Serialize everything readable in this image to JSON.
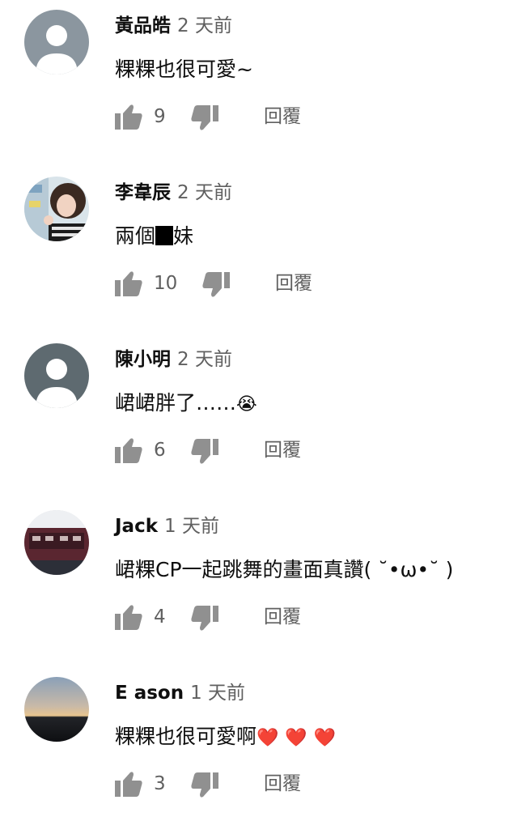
{
  "comments": [
    {
      "author": "黃品皓",
      "time": "2 天前",
      "text": "粿粿也很可愛~",
      "likes": "9",
      "reply": "回覆",
      "avatar": "default"
    },
    {
      "author": "李韋辰",
      "time": "2 天前",
      "text_before": "兩個",
      "text_after": "妹",
      "likes": "10",
      "reply": "回覆",
      "avatar": "photo-person"
    },
    {
      "author": "陳小明",
      "time": "2 天前",
      "text": "峮峮胖了……",
      "emoji": "😭",
      "likes": "6",
      "reply": "回覆",
      "avatar": "default"
    },
    {
      "author": "Jack",
      "time": "1 天前",
      "text": "峮粿CP一起跳舞的畫面真讚( ˘•ω•˘ )",
      "likes": "4",
      "reply": "回覆",
      "avatar": "photo-stadium"
    },
    {
      "author": "E ason",
      "time": "1 天前",
      "text": "粿粿也很可愛啊",
      "hearts": [
        "❤️",
        "❤️",
        "❤️"
      ],
      "likes": "3",
      "reply": "回覆",
      "avatar": "photo-sunset"
    }
  ],
  "icons": {
    "like": "thumbs-up-icon",
    "dislike": "thumbs-down-icon"
  },
  "colors": {
    "text": "#0f0f0f",
    "secondary": "#606060",
    "icon": "#909090",
    "heart": "#e0202a"
  }
}
